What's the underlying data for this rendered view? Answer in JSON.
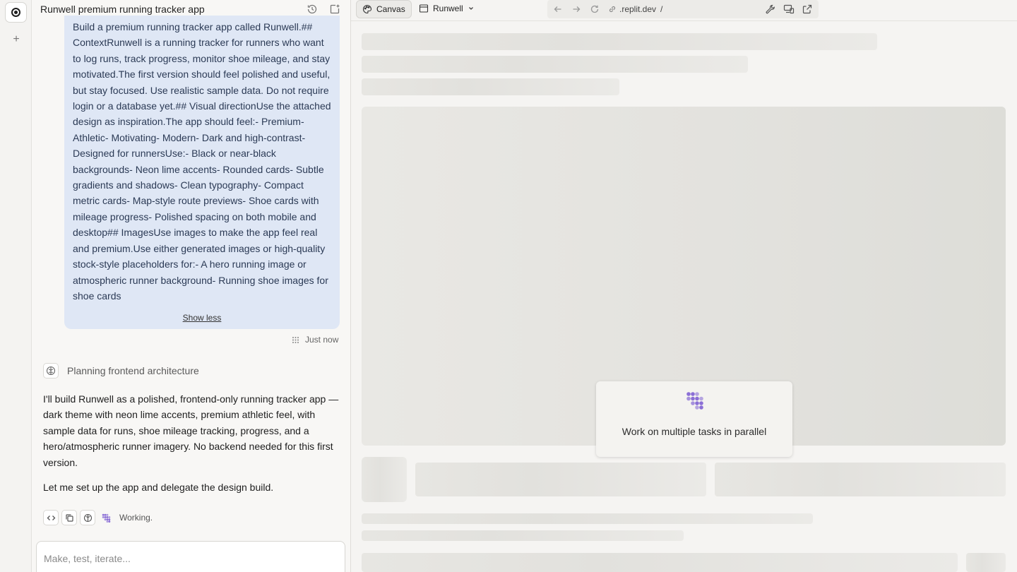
{
  "chat": {
    "title": "Runwell premium running tracker app",
    "user_message": "Build a premium running tracker app called Runwell.## ContextRunwell is a running tracker for runners who want to log runs, track progress, monitor shoe mileage, and stay motivated.The first version should feel polished and useful, but stay focused. Use realistic sample data. Do not require login or a database yet.## Visual directionUse the attached design as inspiration.The app should feel:- Premium- Athletic- Motivating- Modern- Dark and high-contrast- Designed for runnersUse:- Black or near-black backgrounds- Neon lime accents- Rounded cards- Subtle gradients and shadows- Clean typography- Compact metric cards- Map-style route previews- Shoe cards with mileage progress- Polished spacing on both mobile and desktop## ImagesUse images to make the app feel real and premium.Use either generated images or high-quality stock-style placeholders for:- A hero running image or atmospheric runner background- Running shoe images for shoe cards",
    "show_less": "Show less",
    "timestamp": "Just now",
    "planning_label": "Planning frontend architecture",
    "reply_paragraph_1": "I'll build Runwell as a polished, frontend-only running tracker app — dark theme with neon lime accents, premium athletic feel, with sample data for runs, shoe mileage tracking, progress, and a hero/atmospheric runner imagery. No backend needed for this first version.",
    "reply_paragraph_2": "Let me set up the app and delegate the design build.",
    "working_label": "Working.",
    "composer_placeholder": "Make, test, iterate..."
  },
  "canvas": {
    "tab_label": "Canvas",
    "project_label": "Runwell",
    "url": ".replit.dev",
    "url_path": "/",
    "toast_text": "Work on multiple tasks in parallel"
  },
  "icons": {
    "rail": [
      "home-icon",
      "plus-icon"
    ],
    "chat_header": [
      "history-icon",
      "new-chat-icon"
    ],
    "working": [
      "code-icon",
      "copy-icon",
      "brain-icon",
      "agent-icon"
    ],
    "urlbar": [
      "back-icon",
      "forward-icon",
      "reload-icon",
      "link-icon",
      "wrench-icon",
      "devices-icon",
      "external-link-icon"
    ]
  },
  "colors": {
    "bubble_bg": "#dfe7f5",
    "agent_accent": "#8b6fd6"
  }
}
